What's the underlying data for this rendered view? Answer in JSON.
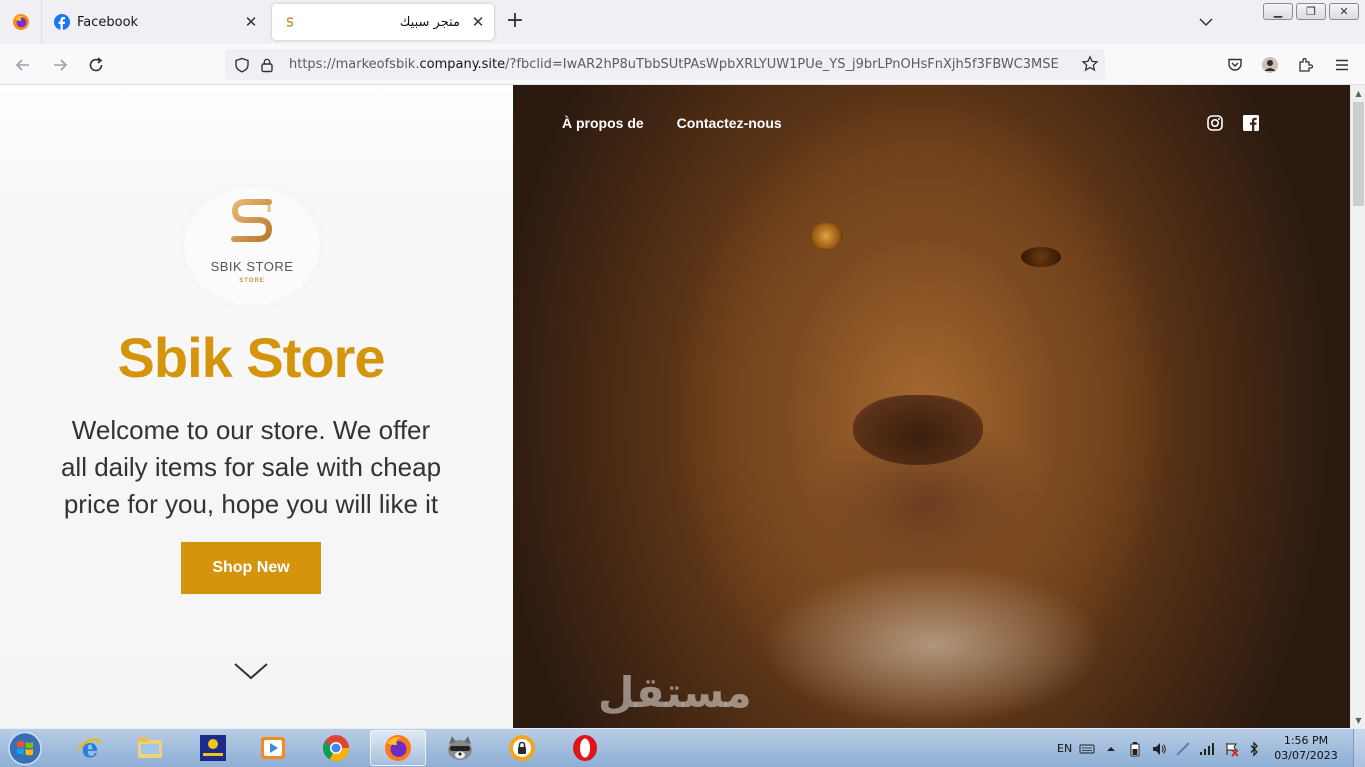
{
  "browser": {
    "tabs": [
      {
        "label": "Facebook",
        "active": false,
        "favicon": "facebook-favicon"
      },
      {
        "label": "متجر سبيك",
        "active": true,
        "favicon": "sbik-favicon"
      }
    ],
    "new_tab_icon": "plus-icon",
    "url": {
      "prefix": "https://markeofsbik.",
      "host": "company.site",
      "suffix": "/?fbclid=IwAR2hP8uTbbSUtPAsWpbXRLYUW1PUe_YS_j9brLPnOHsFnXjh5f3FBWC3MSE"
    }
  },
  "site": {
    "nav": {
      "about": "À propos de",
      "contact": "Contactez-nous"
    },
    "logo": {
      "name": "SBIK STORE",
      "sub": "STORE"
    },
    "title": "Sbik Store",
    "welcome": "Welcome to our store. We offer all daily items for sale with cheap price for you, hope you will like it",
    "cta": "Shop New",
    "watermark": "مستقل",
    "colors": {
      "accent": "#d4950d",
      "logo_gold": "#c9953e"
    }
  },
  "taskbar": {
    "language": "EN",
    "time": "1:56 PM",
    "date": "03/07/2023",
    "apps": [
      "internet-explorer",
      "file-explorer",
      "pixel-app",
      "media-player",
      "chrome",
      "firefox",
      "raccoon-app",
      "vpn-app",
      "opera"
    ]
  }
}
